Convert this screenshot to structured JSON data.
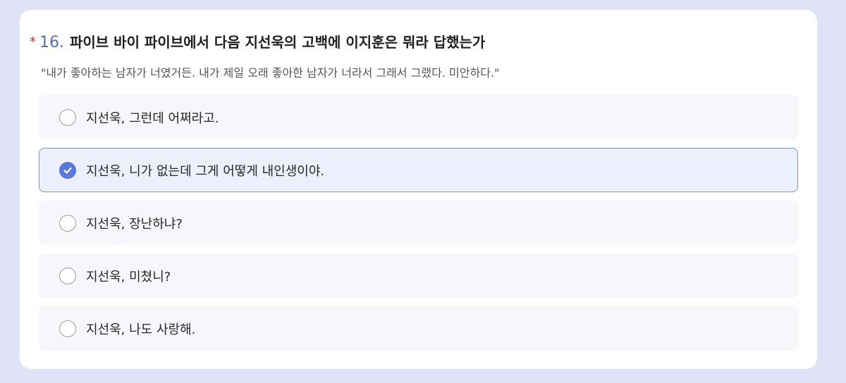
{
  "question": {
    "required_mark": "*",
    "number": "16.",
    "title": "파이브 바이 파이브에서 다음 지선욱의 고백에 이지훈은 뭐라 답했는가",
    "quote": "\"내가 좋아하는 남자가 너였거든. 내가 제일 오래 좋아한 남자가 너라서 그래서 그랬다. 미안하다.\""
  },
  "options": [
    {
      "label": "지선욱, 그런데 어쩌라고.",
      "selected": false
    },
    {
      "label": "지선욱, 니가 없는데 그게 어떻게 내인생이야.",
      "selected": true
    },
    {
      "label": "지선욱, 장난하냐?",
      "selected": false
    },
    {
      "label": "지선욱, 미쳤니?",
      "selected": false
    },
    {
      "label": "지선욱, 나도 사랑해.",
      "selected": false
    }
  ],
  "colors": {
    "accent": "#5a77e0",
    "question_number": "#5a6bb5",
    "required": "#c0392b",
    "selected_background": "#ecf0fc",
    "selected_border": "#8795c2"
  },
  "icons": {
    "selected": "check-icon"
  }
}
